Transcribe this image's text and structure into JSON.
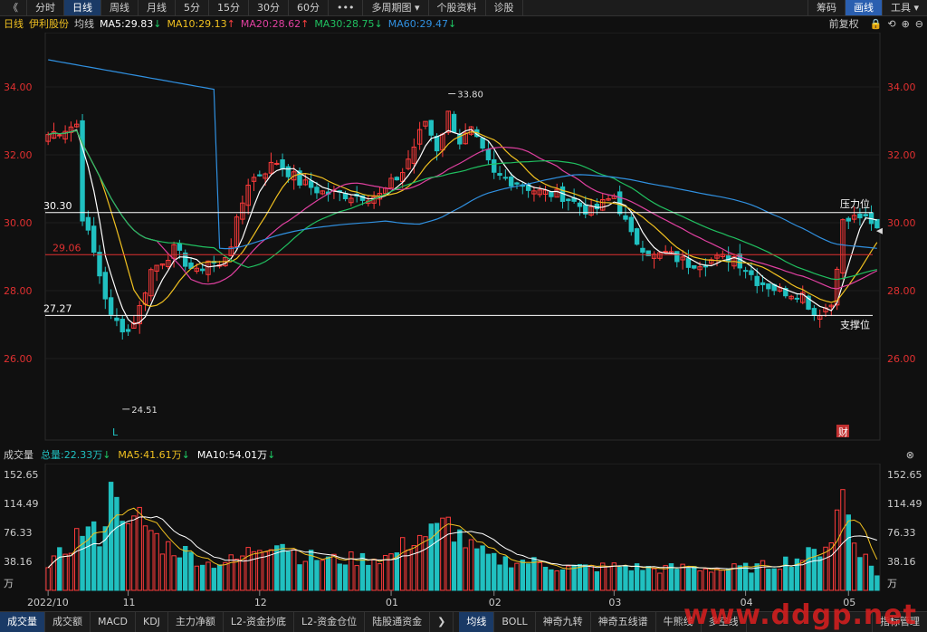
{
  "toolbar": {
    "back_glyph": "《",
    "periods": [
      "分时",
      "日线",
      "周线",
      "月线",
      "5分",
      "15分",
      "30分",
      "60分",
      "•••",
      "多周期图 ▾",
      "个股资料",
      "诊股"
    ],
    "active_period_index": 1,
    "right": [
      "筹码",
      "画线",
      "工具 ▾"
    ],
    "right_active_index": 1
  },
  "main_header": {
    "period": "日线",
    "stock_name": "伊利股份",
    "ma_type": "均线",
    "ma_items": [
      {
        "label": "MA5:29.83",
        "arrow": "↓",
        "arrow_color": "#1ec864",
        "color": "#ffffff"
      },
      {
        "label": "MA10:29.13",
        "arrow": "↑",
        "arrow_color": "#ff4040",
        "color": "#f0c020"
      },
      {
        "label": "MA20:28.62",
        "arrow": "↑",
        "arrow_color": "#ff4040",
        "color": "#e040a0"
      },
      {
        "label": "MA30:28.75",
        "arrow": "↓",
        "arrow_color": "#1ec864",
        "color": "#20c060"
      },
      {
        "label": "MA60:29.47",
        "arrow": "↓",
        "arrow_color": "#1ec864",
        "color": "#3090e0"
      }
    ],
    "adjust": "前复权",
    "controls": [
      "🔒",
      "⟲",
      "⊕",
      "⊖"
    ]
  },
  "volume_header": {
    "title": "成交量",
    "items": [
      {
        "label": "总量:22.33万",
        "arrow": "↓",
        "arrow_color": "#1ec864",
        "color": "#20c0c0"
      },
      {
        "label": "MA5:41.61万",
        "arrow": "↓",
        "arrow_color": "#1ec864",
        "color": "#f0c020"
      },
      {
        "label": "MA10:54.01万",
        "arrow": "↓",
        "arrow_color": "#1ec864",
        "color": "#ffffff"
      }
    ],
    "close": "⊗"
  },
  "bottom_tabs": {
    "left": [
      "成交量",
      "成交额",
      "MACD",
      "KDJ",
      "主力净额",
      "L2-资金抄底",
      "L2-资金仓位",
      "陆股通资金",
      "❯"
    ],
    "left_active_index": 0,
    "right": [
      "均线",
      "BOLL",
      "神奇九转",
      "神奇五线谱",
      "牛熊线",
      "多空线"
    ],
    "right_active_index": 0,
    "settings": "指标管理"
  },
  "watermark": "www.ddgp.net",
  "chart_data": [
    {
      "type": "candlestick",
      "yticks": [
        26.0,
        28.0,
        30.0,
        32.0,
        34.0
      ],
      "ylim": [
        23.6,
        35.6
      ],
      "xticks": [
        "2022/10",
        "11",
        "12",
        "01",
        "02",
        "03",
        "04",
        "05"
      ],
      "xtick_index": [
        0,
        14,
        37,
        60,
        78,
        99,
        122,
        140
      ],
      "candles_count": 146,
      "close_path_keypoints": [
        [
          0,
          32.6
        ],
        [
          5,
          32.9
        ],
        [
          6,
          30.2
        ],
        [
          8,
          29.1
        ],
        [
          11,
          27.2
        ],
        [
          14,
          26.8
        ],
        [
          16,
          27.5
        ],
        [
          18,
          28.6
        ],
        [
          22,
          29.2
        ],
        [
          26,
          28.5
        ],
        [
          28,
          28.9
        ],
        [
          30,
          28.7
        ],
        [
          32,
          29.4
        ],
        [
          35,
          31.2
        ],
        [
          40,
          31.8
        ],
        [
          44,
          31.2
        ],
        [
          48,
          30.9
        ],
        [
          54,
          30.8
        ],
        [
          58,
          30.8
        ],
        [
          62,
          31.5
        ],
        [
          66,
          33.0
        ],
        [
          68,
          32.2
        ],
        [
          70,
          33.2
        ],
        [
          72,
          32.4
        ],
        [
          74,
          32.7
        ],
        [
          78,
          31.4
        ],
        [
          82,
          31.2
        ],
        [
          86,
          30.9
        ],
        [
          90,
          30.8
        ],
        [
          95,
          30.3
        ],
        [
          99,
          30.8
        ],
        [
          102,
          29.6
        ],
        [
          106,
          29.0
        ],
        [
          108,
          29.1
        ],
        [
          112,
          28.8
        ],
        [
          116,
          28.9
        ],
        [
          120,
          29.0
        ],
        [
          124,
          28.3
        ],
        [
          128,
          28.0
        ],
        [
          132,
          27.9
        ],
        [
          134,
          27.3
        ],
        [
          137,
          27.6
        ],
        [
          139,
          30.0
        ],
        [
          142,
          30.2
        ],
        [
          144,
          29.9
        ],
        [
          145,
          29.8
        ]
      ],
      "annotations": [
        {
          "text": "33.80",
          "at_index": 70,
          "value": 33.8
        },
        {
          "text": "24.51",
          "at_index": 13,
          "value": 24.51
        }
      ],
      "hlines": [
        {
          "value": 30.3,
          "label": "30.30",
          "tag": "压力位",
          "color": "#ffffff"
        },
        {
          "value": 29.06,
          "label": "29.06",
          "color": "#e03030"
        },
        {
          "value": 27.27,
          "label": "27.27",
          "tag": "支撑位",
          "color": "#ffffff"
        }
      ],
      "markers": [
        {
          "text": "L",
          "at_index": 12,
          "color": "#20c0c0"
        },
        {
          "text": "财",
          "at_index": 139,
          "color": "#ffffff",
          "bg": "#c03030"
        }
      ],
      "series": [
        {
          "name": "MA5",
          "color": "#ffffff",
          "value_last": 29.83
        },
        {
          "name": "MA10",
          "color": "#f0c020",
          "value_last": 29.13
        },
        {
          "name": "MA20",
          "color": "#e040a0",
          "value_last": 28.62
        },
        {
          "name": "MA30",
          "color": "#20c060",
          "value_last": 28.75
        },
        {
          "name": "MA60",
          "color": "#3090e0",
          "value_last": 29.47
        }
      ]
    },
    {
      "type": "bar",
      "yticks": [
        38.16,
        76.33,
        114.49,
        152.65
      ],
      "ylim": [
        0,
        160
      ],
      "yunit": "万",
      "volume_keypoints": [
        [
          0,
          28
        ],
        [
          6,
          80
        ],
        [
          9,
          72
        ],
        [
          12,
          150
        ],
        [
          14,
          75
        ],
        [
          16,
          95
        ],
        [
          20,
          60
        ],
        [
          24,
          50
        ],
        [
          28,
          35
        ],
        [
          33,
          40
        ],
        [
          36,
          55
        ],
        [
          40,
          70
        ],
        [
          44,
          45
        ],
        [
          50,
          40
        ],
        [
          56,
          42
        ],
        [
          60,
          45
        ],
        [
          64,
          70
        ],
        [
          68,
          78
        ],
        [
          70,
          88
        ],
        [
          74,
          55
        ],
        [
          78,
          40
        ],
        [
          84,
          38
        ],
        [
          90,
          30
        ],
        [
          96,
          30
        ],
        [
          100,
          32
        ],
        [
          106,
          28
        ],
        [
          112,
          30
        ],
        [
          118,
          28
        ],
        [
          124,
          30
        ],
        [
          130,
          40
        ],
        [
          134,
          48
        ],
        [
          137,
          70
        ],
        [
          139,
          130
        ],
        [
          141,
          70
        ],
        [
          143,
          42
        ],
        [
          145,
          22
        ]
      ]
    }
  ]
}
